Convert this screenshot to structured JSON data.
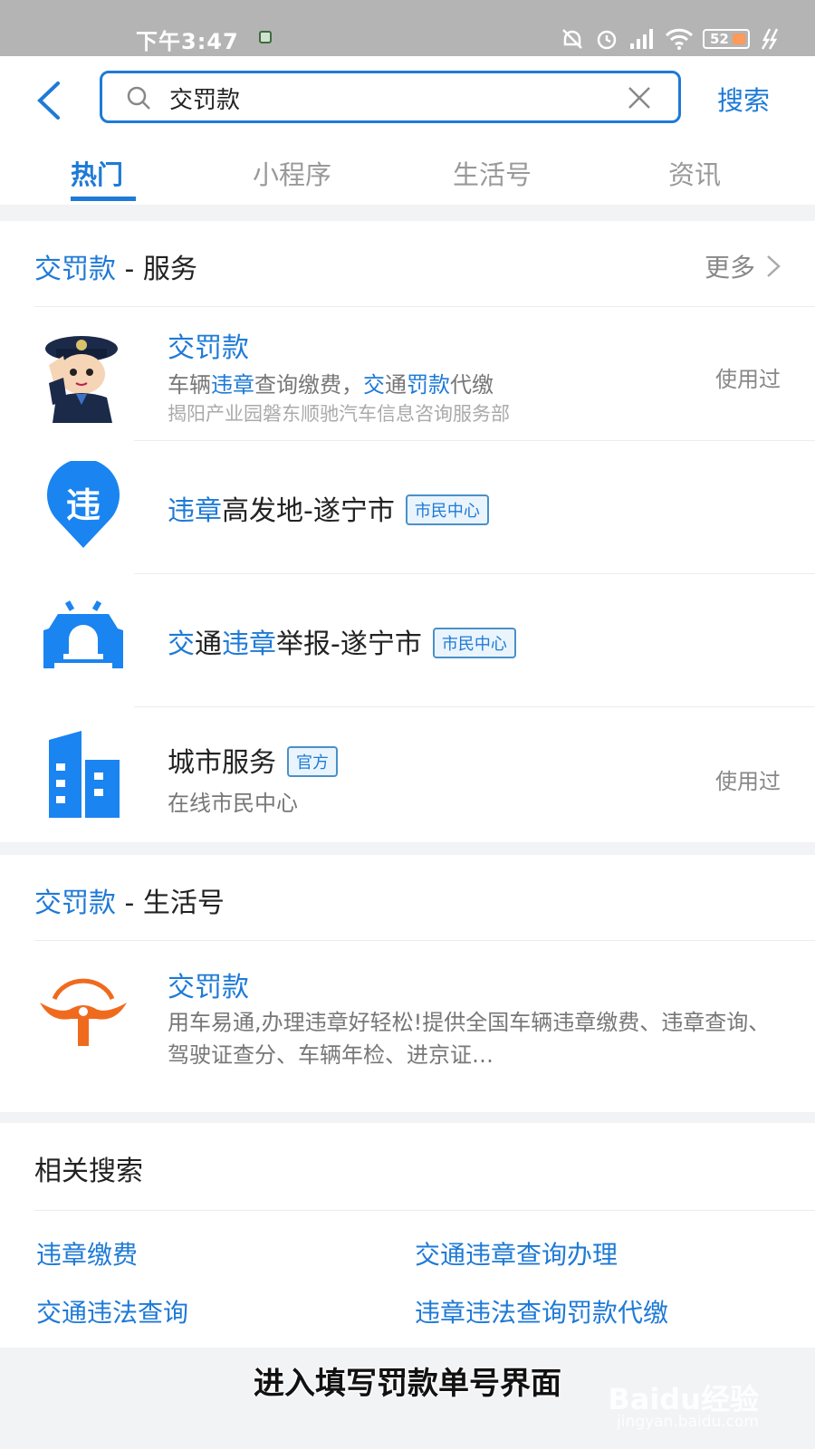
{
  "status_bar": {
    "time": "下午3:47",
    "battery": "52"
  },
  "search": {
    "query": "交罚款",
    "button_label": "搜索"
  },
  "tabs": [
    {
      "label": "热门",
      "active": true
    },
    {
      "label": "小程序",
      "active": false
    },
    {
      "label": "生活号",
      "active": false
    },
    {
      "label": "资讯",
      "active": false
    }
  ],
  "services_section": {
    "keyword": "交罚款",
    "title_suffix": " - 服务",
    "more_label": "更多",
    "items": [
      {
        "title": "交罚款",
        "desc_parts": [
          "车辆",
          "违章",
          "查询缴费，",
          "交",
          "通",
          "罚款",
          "代缴"
        ],
        "sub": "揭阳产业园磐东顺驰汽车信息咨询服务部",
        "used": "使用过"
      },
      {
        "title_parts": [
          "违章",
          "高发地-遂宁市"
        ],
        "badge": "市民中心"
      },
      {
        "title_parts": [
          "交",
          "通",
          "违章",
          "举报-遂宁市"
        ],
        "badge": "市民中心"
      },
      {
        "title": "城市服务",
        "badge": "官方",
        "desc": "在线市民中心",
        "used": "使用过"
      }
    ]
  },
  "life_section": {
    "keyword": "交罚款",
    "title_suffix": " - 生活号",
    "item": {
      "title": "交罚款",
      "desc": "用车易通,办理违章好轻松!提供全国车辆违章缴费、违章查询、驾驶证查分、车辆年检、进京证…"
    }
  },
  "related": {
    "title": "相关搜索",
    "links": [
      "违章缴费",
      "交通违章查询办理",
      "交通违法查询",
      "违章违法查询罚款代缴"
    ]
  },
  "caption": "进入填写罚款单号界面",
  "watermark": {
    "brand": "Baidu经验",
    "url": "jingyan.baidu.com"
  },
  "colors": {
    "accent": "#1e7ad6",
    "status_bar": "#b4b4b4",
    "background": "#f2f3f5"
  }
}
